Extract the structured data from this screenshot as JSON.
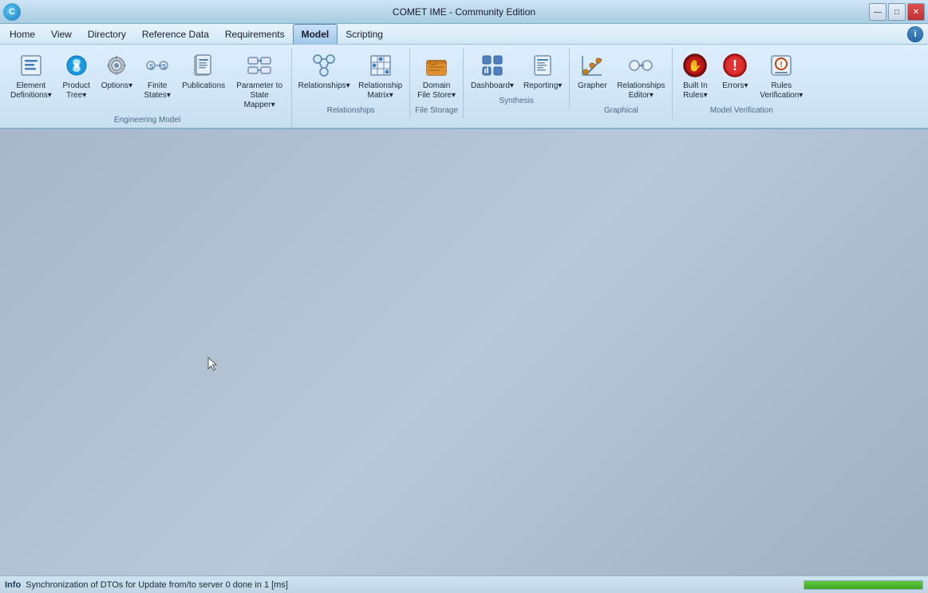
{
  "titleBar": {
    "title": "COMET IME - Community Edition",
    "controls": {
      "minimize": "—",
      "maximize": "□",
      "close": "✕"
    }
  },
  "menuBar": {
    "items": [
      {
        "id": "home",
        "label": "Home",
        "active": false
      },
      {
        "id": "view",
        "label": "View",
        "active": false
      },
      {
        "id": "directory",
        "label": "Directory",
        "active": false
      },
      {
        "id": "reference-data",
        "label": "Reference Data",
        "active": false
      },
      {
        "id": "requirements",
        "label": "Requirements",
        "active": false
      },
      {
        "id": "model",
        "label": "Model",
        "active": true
      },
      {
        "id": "scripting",
        "label": "Scripting",
        "active": false
      }
    ]
  },
  "ribbon": {
    "groups": [
      {
        "id": "engineering-model",
        "label": "Engineering Model",
        "items": [
          {
            "id": "element-definitions",
            "label": "Element\nDefinitions",
            "hasDropdown": true,
            "icon": "element-def-icon"
          },
          {
            "id": "product-tree",
            "label": "Product\nTree",
            "hasDropdown": true,
            "icon": "product-tree-icon"
          },
          {
            "id": "options",
            "label": "Options",
            "hasDropdown": true,
            "icon": "options-icon"
          },
          {
            "id": "finite-states",
            "label": "Finite\nStates",
            "hasDropdown": true,
            "icon": "finite-states-icon"
          },
          {
            "id": "publications",
            "label": "Publications",
            "hasDropdown": false,
            "icon": "publications-icon"
          },
          {
            "id": "parameter-to-state-mapper",
            "label": "Parameter to\nState Mapper",
            "hasDropdown": true,
            "icon": "param-mapper-icon"
          }
        ]
      },
      {
        "id": "relationships",
        "label": "Relationships",
        "items": [
          {
            "id": "relationships",
            "label": "Relationships",
            "hasDropdown": true,
            "icon": "relationships-icon"
          },
          {
            "id": "relationship-matrix",
            "label": "Relationship\nMatrix",
            "hasDropdown": true,
            "icon": "rel-matrix-icon"
          }
        ]
      },
      {
        "id": "file-storage",
        "label": "File Storage",
        "items": [
          {
            "id": "domain-file-store",
            "label": "Domain\nFile Store",
            "hasDropdown": true,
            "icon": "file-store-icon"
          }
        ]
      },
      {
        "id": "synthesis",
        "label": "Synthesis",
        "items": [
          {
            "id": "dashboard",
            "label": "Dashboard",
            "hasDropdown": true,
            "icon": "dashboard-icon"
          },
          {
            "id": "reporting",
            "label": "Reporting",
            "hasDropdown": true,
            "icon": "reporting-icon"
          }
        ]
      },
      {
        "id": "graphical",
        "label": "Graphical",
        "items": [
          {
            "id": "grapher",
            "label": "Grapher",
            "hasDropdown": false,
            "icon": "grapher-icon"
          },
          {
            "id": "relationships-editor",
            "label": "Relationships\nEditor",
            "hasDropdown": true,
            "icon": "rel-editor-icon"
          }
        ]
      },
      {
        "id": "model-verification",
        "label": "Model Verification",
        "items": [
          {
            "id": "built-in-rules",
            "label": "Built In\nRules",
            "hasDropdown": true,
            "icon": "built-in-rules-icon"
          },
          {
            "id": "errors",
            "label": "Errors",
            "hasDropdown": true,
            "icon": "errors-icon"
          },
          {
            "id": "rules-verification",
            "label": "Rules\nVerification",
            "hasDropdown": true,
            "icon": "rules-verification-icon"
          }
        ]
      }
    ]
  },
  "statusBar": {
    "label": "Info",
    "message": "Synchronization of DTOs for Update from/to server 0 done in 1 [ms]",
    "progress": 100
  }
}
